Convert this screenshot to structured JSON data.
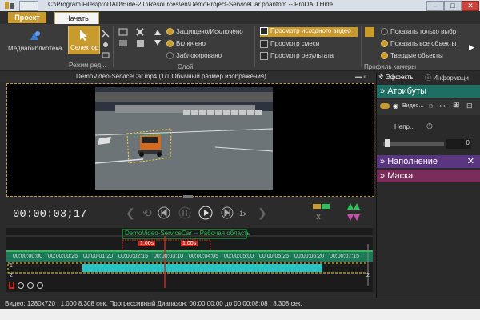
{
  "window": {
    "title": "C:\\Program Files\\proDAD\\Hide-2.0\\Resources\\en\\DemoProject-ServiceCar.phantom -- ProDAD Hide",
    "minimize": "–",
    "maximize": "□",
    "close": "✕"
  },
  "tabs": [
    {
      "label": "Проект"
    },
    {
      "label": "Начать"
    }
  ],
  "ribbon": {
    "media_library": "Медиабиблиотека",
    "selector": "Селектор",
    "edit_mode": "Режим ред...",
    "layer_group": "Слой",
    "protected": "Защищено/Исключено",
    "enabled": "Включено",
    "locked": "Заблокировано",
    "preview_source": "Просмотр исходного видео",
    "preview_mix": "Просмотр смеси",
    "preview_result": "Просмотр результата",
    "camera_profile": "Профиль камеры",
    "show_only_selected": "Показать только выбр",
    "show_all_objects": "Показать все объекты",
    "solid_objects": "Твердые объекты"
  },
  "player": {
    "header": "DemoVideo-ServiceCar.mp4  (1/1  Обычный размер изображения)",
    "timecode": "00:00:03;17",
    "speed": "1x"
  },
  "timeline": {
    "workspace_label": "DemoVideo-ServiceCar -- Рабочая область",
    "marker1": "1.00s",
    "marker2": "1.00s",
    "ticks": [
      "00:00:00;00",
      "00:00:00;25",
      "00:00:01;20",
      "00:00:02;15",
      "00:00:03;10",
      "00:00:04;05",
      "00:00:05;00",
      "00:00:05;25",
      "00:00:06;20",
      "00:00:07;15"
    ],
    "track_nums": [
      "1",
      "2",
      "2"
    ]
  },
  "status": {
    "text": "Видео: 1280x720 : 1,000   8,308 сек.   Прогрессивный   Диапазон: 00:00:00;00 до 00:00:08;08 : 8,308 сек."
  },
  "right_panel": {
    "tab_effects": "Эффекты",
    "tab_info": "Информаци",
    "attributes": "Атрибуты",
    "layer_label": "Видео...",
    "opacity_label": "Непр...",
    "value": "0",
    "fill": "Наполнение",
    "mask": "Маска"
  },
  "colors": {
    "accent": "#c99a2e",
    "attributes_bg": "#1e6f63",
    "fill_bg": "#5a3580",
    "mask_bg": "#7a2d5a",
    "timeline_bar": "#29c3c3",
    "workspace_green": "#2fbf5a",
    "marker_red": "#d0241c"
  }
}
